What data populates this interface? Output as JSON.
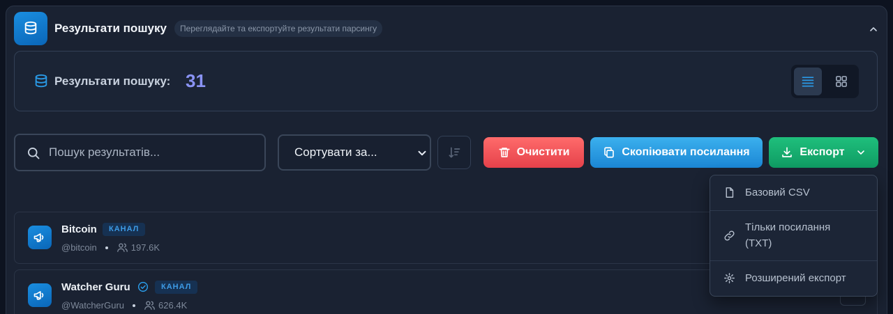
{
  "header": {
    "title": "Результати пошуку",
    "subtitle": "Переглядайте та експортуйте результати парсингу"
  },
  "summary": {
    "label": "Результати пошуку:",
    "count": "31"
  },
  "toolbar": {
    "search_placeholder": "Пошук результатів...",
    "sort_label": "Сортувати за...",
    "clear_label": "Очистити",
    "copy_label": "Скопіювати посилання",
    "export_label": "Експорт"
  },
  "export_menu": {
    "items": [
      {
        "label": "Базовий CSV",
        "icon": "file-icon"
      },
      {
        "label": "Тільки посилання (TXT)",
        "icon": "link-icon"
      },
      {
        "label": "Розширений експорт",
        "icon": "gear-icon"
      }
    ]
  },
  "results": [
    {
      "name": "Bitcoin",
      "verified": false,
      "badge": "КАНАЛ",
      "handle": "@bitcoin",
      "members": "197.6K"
    },
    {
      "name": "Watcher Guru",
      "verified": true,
      "badge": "КАНАЛ",
      "handle": "@WatcherGuru",
      "members": "626.4K"
    }
  ],
  "colors": {
    "accent": "#8a93f5",
    "clear": "#f0555b",
    "copy": "#2c9be2",
    "export": "#16ad6f"
  }
}
